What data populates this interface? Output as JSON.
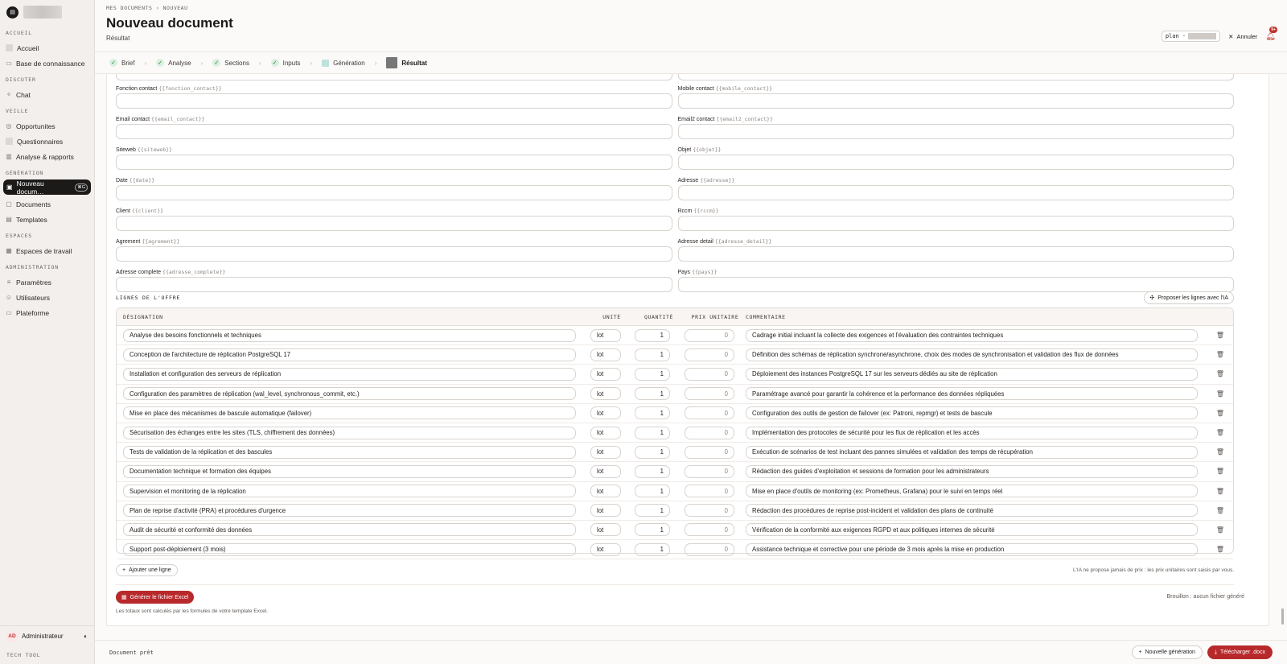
{
  "sidebar": {
    "sections": {
      "accueil": "ACCUEIL",
      "discuter": "DISCUTER",
      "veille": "VEILLE",
      "generation": "GÉNÉRATION",
      "espaces": "ESPACES",
      "administration": "ADMINISTRATION"
    },
    "items": {
      "accueil": "Accueil",
      "base": "Base de connaissance",
      "chat": "Chat",
      "opportunites": "Opportunites",
      "questionnaires": "Questionnaires",
      "analyse": "Analyse & rapports",
      "nouveau": "Nouveau docum…",
      "nouveau_kbd": "⌘G",
      "documents": "Documents",
      "templates": "Templates",
      "espaces_travail": "Espaces de travail",
      "parametres": "Paramètres",
      "utilisateurs": "Utilisateurs",
      "plateforme": "Plateforme"
    },
    "user": {
      "initials": "AD",
      "name": "Administrateur"
    },
    "footer": "TECH TOOL"
  },
  "header": {
    "breadcrumb": "MES DOCUMENTS  ›  NOUVEAU",
    "title": "Nouveau document",
    "subtitle": "Résultat",
    "plan_label": "plan ·",
    "cancel": "Annuler",
    "notif_badge": "9+"
  },
  "steps": [
    {
      "label": "Brief",
      "state": "done"
    },
    {
      "label": "Analyse",
      "state": "done"
    },
    {
      "label": "Sections",
      "state": "done"
    },
    {
      "label": "Inputs",
      "state": "done"
    },
    {
      "label": "Génération",
      "state": "pending"
    },
    {
      "label": "Résultat",
      "state": "current"
    }
  ],
  "fields": {
    "fonction_contact": {
      "label": "Fonction contact",
      "ph": "{{fonction_contact}}",
      "value": ""
    },
    "mobile_contact": {
      "label": "Mobile contact",
      "ph": "{{mobile_contact}}",
      "value": ""
    },
    "email_contact": {
      "label": "Email contact",
      "ph": "{{email_contact}}",
      "value": ""
    },
    "email2_contact": {
      "label": "Email2 contact",
      "ph": "{{email2_contact}}",
      "value": ""
    },
    "siteweb": {
      "label": "Siteweb",
      "ph": "{{siteweb}}",
      "value": ""
    },
    "objet": {
      "label": "Objet",
      "ph": "{{objet}}",
      "value": ""
    },
    "date": {
      "label": "Date",
      "ph": "{{date}}",
      "value": ""
    },
    "adresse": {
      "label": "Adresse",
      "ph": "{{adresse}}",
      "value": ""
    },
    "client": {
      "label": "Client",
      "ph": "{{client}}",
      "value": ""
    },
    "rccm": {
      "label": "Rccm",
      "ph": "{{rccm}}",
      "value": ""
    },
    "agrement": {
      "label": "Agrement",
      "ph": "{{agrement}}",
      "value": ""
    },
    "adresse_detail": {
      "label": "Adresse detail",
      "ph": "{{adresse_detail}}",
      "value": ""
    },
    "adresse_complete": {
      "label": "Adresse complete",
      "ph": "{{adresse_complete}}",
      "value": ""
    },
    "pays": {
      "label": "Pays",
      "ph": "{{pays}}",
      "value": ""
    }
  },
  "lines": {
    "title": "LIGNES DE L'OFFRE",
    "ai_button": "Proposer les lignes avec l'IA",
    "columns": {
      "designation": "DÉSIGNATION",
      "unite": "UNITÉ",
      "quantite": "QUANTITÉ",
      "prix": "PRIX UNITAIRE",
      "commentaire": "COMMENTAIRE"
    },
    "rows": [
      {
        "designation": "Analyse des besoins fonctionnels et techniques",
        "unite": "lot",
        "quantite": "1",
        "prix": "0",
        "commentaire": "Cadrage initial incluant la collecte des exigences et l'évaluation des contraintes techniques"
      },
      {
        "designation": "Conception de l'architecture de réplication PostgreSQL 17",
        "unite": "lot",
        "quantite": "1",
        "prix": "0",
        "commentaire": "Définition des schémas de réplication synchrone/asynchrone, choix des modes de synchronisation et validation des flux de données"
      },
      {
        "designation": "Installation et configuration des serveurs de réplication",
        "unite": "lot",
        "quantite": "1",
        "prix": "0",
        "commentaire": "Déploiement des instances PostgreSQL 17 sur les serveurs dédiés au site de réplication"
      },
      {
        "designation": "Configuration des paramètres de réplication (wal_level, synchronous_commit, etc.)",
        "unite": "lot",
        "quantite": "1",
        "prix": "0",
        "commentaire": "Paramétrage avancé pour garantir la cohérence et la performance des données répliquées"
      },
      {
        "designation": "Mise en place des mécanismes de bascule automatique (failover)",
        "unite": "lot",
        "quantite": "1",
        "prix": "0",
        "commentaire": "Configuration des outils de gestion de failover (ex: Patroni, repmgr) et tests de bascule"
      },
      {
        "designation": "Sécurisation des échanges entre les sites (TLS, chiffrement des données)",
        "unite": "lot",
        "quantite": "1",
        "prix": "0",
        "commentaire": "Implémentation des protocoles de sécurité pour les flux de réplication et les accès"
      },
      {
        "designation": "Tests de validation de la réplication et des bascules",
        "unite": "lot",
        "quantite": "1",
        "prix": "0",
        "commentaire": "Exécution de scénarios de test incluant des pannes simulées et validation des temps de récupération"
      },
      {
        "designation": "Documentation technique et formation des équipes",
        "unite": "lot",
        "quantite": "1",
        "prix": "0",
        "commentaire": "Rédaction des guides d'exploitation et sessions de formation pour les administrateurs"
      },
      {
        "designation": "Supervision et monitoring de la réplication",
        "unite": "lot",
        "quantite": "1",
        "prix": "0",
        "commentaire": "Mise en place d'outils de monitoring (ex: Prometheus, Grafana) pour le suivi en temps réel"
      },
      {
        "designation": "Plan de reprise d'activité (PRA) et procédures d'urgence",
        "unite": "lot",
        "quantite": "1",
        "prix": "0",
        "commentaire": "Rédaction des procédures de reprise post-incident et validation des plans de continuité"
      },
      {
        "designation": "Audit de sécurité et conformité des données",
        "unite": "lot",
        "quantite": "1",
        "prix": "0",
        "commentaire": "Vérification de la conformité aux exigences RGPD et aux politiques internes de sécurité"
      },
      {
        "designation": "Support post-déploiement (3 mois)",
        "unite": "lot",
        "quantite": "1",
        "prix": "0",
        "commentaire": "Assistance technique et corrective pour une période de 3 mois après la mise en production"
      }
    ],
    "add_line": "Ajouter une ligne",
    "ai_note": "L'IA ne propose jamais de prix : les prix unitaires sont saisis par vous."
  },
  "excel": {
    "generate": "Générer le fichier Excel",
    "draft_status": "Brouillon : aucun fichier généré",
    "totals_note": "Les totaux sont calculés par les formules de votre template Excel."
  },
  "footer": {
    "status": "Document prêt",
    "new_generation": "Nouvelle génération",
    "download": "Télécharger .docx"
  },
  "colors": {
    "accent_red": "#b8292b",
    "check_green": "#267a3a",
    "sidebar_bg": "#f3efec"
  }
}
